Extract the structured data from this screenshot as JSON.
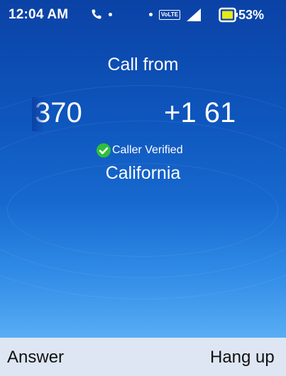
{
  "status_bar": {
    "time": "12:04 AM",
    "network_badge": "VoLTE",
    "battery_percent": "53%",
    "battery_level": 0.53,
    "battery_color": "#e7e81c",
    "icons": [
      "call-icon",
      "notification-dot",
      "volte-icon",
      "signal-icon",
      "battery-icon"
    ]
  },
  "call": {
    "title": "Call from",
    "number_fragment": "370",
    "number_main": "+1 61",
    "verified_label": "Caller Verified",
    "verified_color": "#2fbf3a",
    "location": "California"
  },
  "softkeys": {
    "left": "Answer",
    "right": "Hang up"
  }
}
